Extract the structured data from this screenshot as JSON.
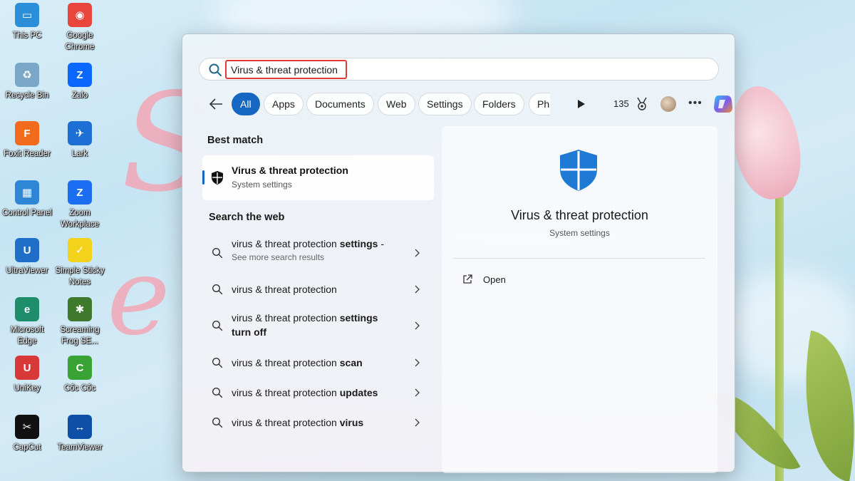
{
  "desktop_icons": [
    {
      "label": "This PC",
      "color": "#2a8fd8",
      "glyph": "▭"
    },
    {
      "label": "Google Chrome",
      "color": "#e8453c",
      "glyph": "◉"
    },
    {
      "label": "Recycle Bin",
      "color": "#7aa7c7",
      "glyph": "♻"
    },
    {
      "label": "Zalo",
      "color": "#0a68ff",
      "glyph": "Z"
    },
    {
      "label": "Foxit Reader",
      "color": "#f26a1b",
      "glyph": "F"
    },
    {
      "label": "Lark",
      "color": "#1d6fd6",
      "glyph": "✈"
    },
    {
      "label": "Control Panel",
      "color": "#2f86d6",
      "glyph": "▦"
    },
    {
      "label": "Zoom Workplace",
      "color": "#1b6df2",
      "glyph": "Z"
    },
    {
      "label": "UltraViewer",
      "color": "#1f6fc8",
      "glyph": "U"
    },
    {
      "label": "Simple Sticky Notes",
      "color": "#f2d21b",
      "glyph": "✓"
    },
    {
      "label": "Microsoft Edge",
      "color": "#1e8e6a",
      "glyph": "e"
    },
    {
      "label": "Screaming Frog SE...",
      "color": "#3f7a2c",
      "glyph": "✱"
    },
    {
      "label": "UniKey",
      "color": "#d93838",
      "glyph": "U"
    },
    {
      "label": "Cốc Cốc",
      "color": "#3aa335",
      "glyph": "C"
    },
    {
      "label": "CapCut",
      "color": "#111111",
      "glyph": "✂"
    },
    {
      "label": "TeamViewer",
      "color": "#0e4fa8",
      "glyph": "↔"
    }
  ],
  "search": {
    "value": "Virus & threat protection"
  },
  "filters": {
    "chips": [
      "All",
      "Apps",
      "Documents",
      "Web",
      "Settings",
      "Folders",
      "Ph"
    ],
    "active_index": 0,
    "points": "135"
  },
  "best_match": {
    "heading": "Best match",
    "title": "Virus & threat protection",
    "subtitle": "System settings"
  },
  "web": {
    "heading": "Search the web",
    "results": [
      {
        "prefix": "virus & threat protection ",
        "bold": "settings",
        "suffix": " -",
        "sub": "See more search results"
      },
      {
        "prefix": "virus & threat protection",
        "bold": "",
        "suffix": "",
        "sub": ""
      },
      {
        "prefix": "virus & threat protection ",
        "bold": "settings turn off",
        "suffix": "",
        "sub": ""
      },
      {
        "prefix": "virus & threat protection ",
        "bold": "scan",
        "suffix": "",
        "sub": ""
      },
      {
        "prefix": "virus & threat protection ",
        "bold": "updates",
        "suffix": "",
        "sub": ""
      },
      {
        "prefix": "virus & threat protection ",
        "bold": "virus",
        "suffix": "",
        "sub": ""
      }
    ]
  },
  "detail": {
    "title": "Virus & threat protection",
    "subtitle": "System settings",
    "action_open": "Open"
  },
  "colors": {
    "accent": "#1667c1",
    "highlight_border": "#e53935",
    "shield_blue": "#1f7ad6"
  }
}
